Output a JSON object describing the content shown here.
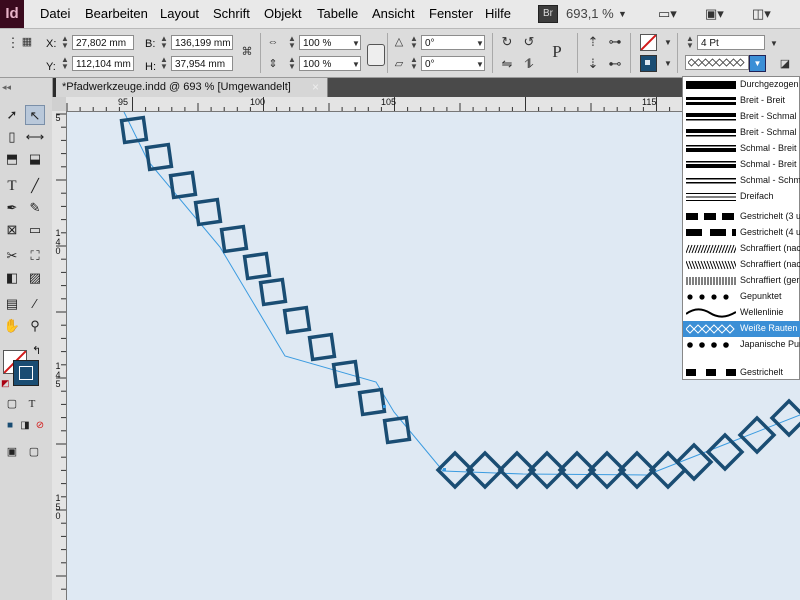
{
  "app": {
    "logo": "Id"
  },
  "menu": [
    "Datei",
    "Bearbeiten",
    "Layout",
    "Schrift",
    "Objekt",
    "Tabelle",
    "Ansicht",
    "Fenster",
    "Hilfe"
  ],
  "bridge_badge": "Br",
  "zoom_level": "693,1 %",
  "controls": {
    "x_label": "X:",
    "x_value": "27,802 mm",
    "y_label": "Y:",
    "y_value": "112,104 mm",
    "w_label": "B:",
    "w_value": "136,199 mm",
    "h_label": "H:",
    "h_value": "37,954 mm",
    "scale_x": "100 %",
    "scale_y": "100 %",
    "rotation": "0°",
    "shear": "0°",
    "stroke_weight": "4 Pt"
  },
  "document_tab": {
    "title": "*Pfadwerkzeuge.indd @ 693 % [Umgewandelt]",
    "close_symbol": "×"
  },
  "ruler": {
    "h_labels": [
      "95",
      "100",
      "105",
      "115"
    ],
    "v_labels": [
      "5",
      "140",
      "145",
      "150"
    ]
  },
  "stroke_types": [
    {
      "label": "Durchgezogen",
      "style": "solid-thick",
      "selected": false
    },
    {
      "label": "Breit - Breit",
      "style": "thick-thick",
      "selected": false
    },
    {
      "label": "Breit - Schmal",
      "style": "thick-thin",
      "selected": false
    },
    {
      "label": "Breit - Schmal",
      "style": "thick-thin-2",
      "selected": false
    },
    {
      "label": "Schmal - Breit",
      "style": "thin-thick",
      "selected": false
    },
    {
      "label": "Schmal - Breit",
      "style": "thin-thick-2",
      "selected": false
    },
    {
      "label": "Schmal - Schmal",
      "style": "thin-thin",
      "selected": false
    },
    {
      "label": "Dreifach",
      "style": "triple",
      "selected": false
    },
    {
      "label": "Gestrichelt (3 u",
      "style": "dash-3",
      "selected": false
    },
    {
      "label": "Gestrichelt (4 u",
      "style": "dash-4",
      "selected": false
    },
    {
      "label": "Schraffiert (nac",
      "style": "hatch-left",
      "selected": false
    },
    {
      "label": "Schraffiert (nac",
      "style": "hatch-right",
      "selected": false
    },
    {
      "label": "Schraffiert (ger",
      "style": "hatch-straight",
      "selected": false
    },
    {
      "label": "Gepunktet",
      "style": "dotted",
      "selected": false
    },
    {
      "label": "Wellenlinie",
      "style": "wavy",
      "selected": false
    },
    {
      "label": "Weiße Rauten",
      "style": "white-diamonds",
      "selected": true
    },
    {
      "label": "Japanische Pun",
      "style": "japanese-dots",
      "selected": false
    },
    {
      "label": "Gestrichelt",
      "style": "dashed",
      "selected": false
    }
  ],
  "colors": {
    "stroke_blue": "#1a4d73",
    "selection_blue": "#3b8fd6",
    "canvas_bg": "#dfe9f3",
    "path_line": "#3b9be0"
  },
  "icons": [
    "selection-icon",
    "direct-selection-icon",
    "page-icon",
    "gap-icon",
    "content-collector-icon",
    "content-placer-icon",
    "type-icon",
    "line-icon",
    "pen-icon",
    "pencil-icon",
    "rectangle-frame-icon",
    "rectangle-icon",
    "scissors-icon",
    "free-transform-icon",
    "gradient-swatch-icon",
    "gradient-feather-icon",
    "note-icon",
    "eyedropper-icon",
    "hand-icon",
    "zoom-icon"
  ]
}
